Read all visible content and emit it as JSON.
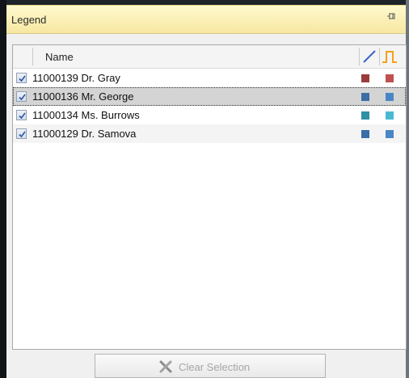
{
  "panel": {
    "title": "Legend",
    "pin_icon": "pin-icon"
  },
  "columns": {
    "name_label": "Name",
    "line_icon": "line-style-icon",
    "bar_icon": "pulse-chart-icon",
    "line_icon_color": "#3a67c8",
    "bar_icon_color": "#f5a017"
  },
  "rows": [
    {
      "label": "11000139 Dr. Gray",
      "checked": true,
      "line_color": "#9c3b3b",
      "bar_color": "#c05050",
      "selected": false
    },
    {
      "label": "11000136 Mr. George",
      "checked": true,
      "line_color": "#3a6ea5",
      "bar_color": "#4a86c5",
      "selected": true
    },
    {
      "label": "11000134 Ms. Burrows",
      "checked": true,
      "line_color": "#2f8fa5",
      "bar_color": "#49b9d1",
      "selected": false
    },
    {
      "label": "11000129 Dr. Samova",
      "checked": true,
      "line_color": "#3a6ea5",
      "bar_color": "#4a86c5",
      "selected": false
    }
  ],
  "clear_button": {
    "label": "Clear Selection",
    "icon": "clear-x-icon",
    "enabled": false
  }
}
